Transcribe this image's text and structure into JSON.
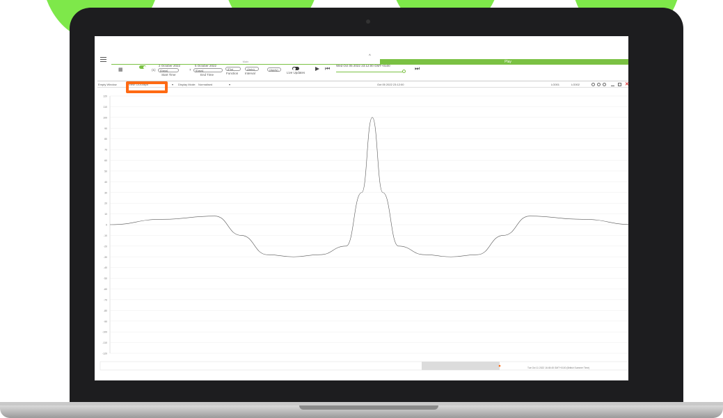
{
  "app": {
    "menu_icon": "hamburger-icon",
    "bar_left_label": "Main",
    "bar_right_label": "Play",
    "collapse_icon": "chevron-up-icon",
    "accent_color": "#7ac143",
    "highlight_color": "#ff6a13"
  },
  "toolbar": {
    "start_date": "2 October 2022",
    "start_num": "(1)",
    "start_unit": "[Days]",
    "start_caption": "Start Time",
    "end_date": "5 October 2022",
    "end_num": "7",
    "end_unit": "[Days]",
    "end_caption": "End Time",
    "function_value": "[Plot",
    "function_caption": "Function",
    "interval_value": "(Auto)",
    "interval_caption": "Interval",
    "apply_label": "(Apply)",
    "live_updates_label": "Live Updates",
    "datetime": "Wed Oct 05 2022 23:12:00 GMT+0100"
  },
  "subbar": {
    "empty_window": "Empty Window",
    "view_label": "View: DOGraph",
    "display_mode_label": "Display Mode:",
    "display_mode_value": "Normalised",
    "center_date": "Oct 05 2022 23:12:00",
    "right_label_1": "LG001",
    "right_label_2": "LG002"
  },
  "chart_data": {
    "type": "line",
    "ylim": [
      -120,
      120
    ],
    "yticks": [
      120,
      110,
      100,
      90,
      80,
      70,
      60,
      50,
      40,
      30,
      20,
      10,
      0,
      -10,
      -20,
      -30,
      -40,
      -50,
      -60,
      -70,
      -80,
      -90,
      -100,
      -110,
      -120
    ],
    "x": [
      0,
      10,
      20,
      25,
      30,
      35,
      40,
      45,
      48,
      50,
      52,
      55,
      60,
      65,
      70,
      75,
      80,
      90,
      100
    ],
    "series": [
      {
        "values": [
          0,
          5,
          8,
          -10,
          -28,
          -30,
          -28,
          -20,
          30,
          100,
          30,
          -20,
          -28,
          -30,
          -28,
          -10,
          8,
          5,
          0
        ]
      }
    ],
    "footer_date": "Tue Oct 11 2022 16:45:45 GMT+0100 (British Summer Time)"
  }
}
